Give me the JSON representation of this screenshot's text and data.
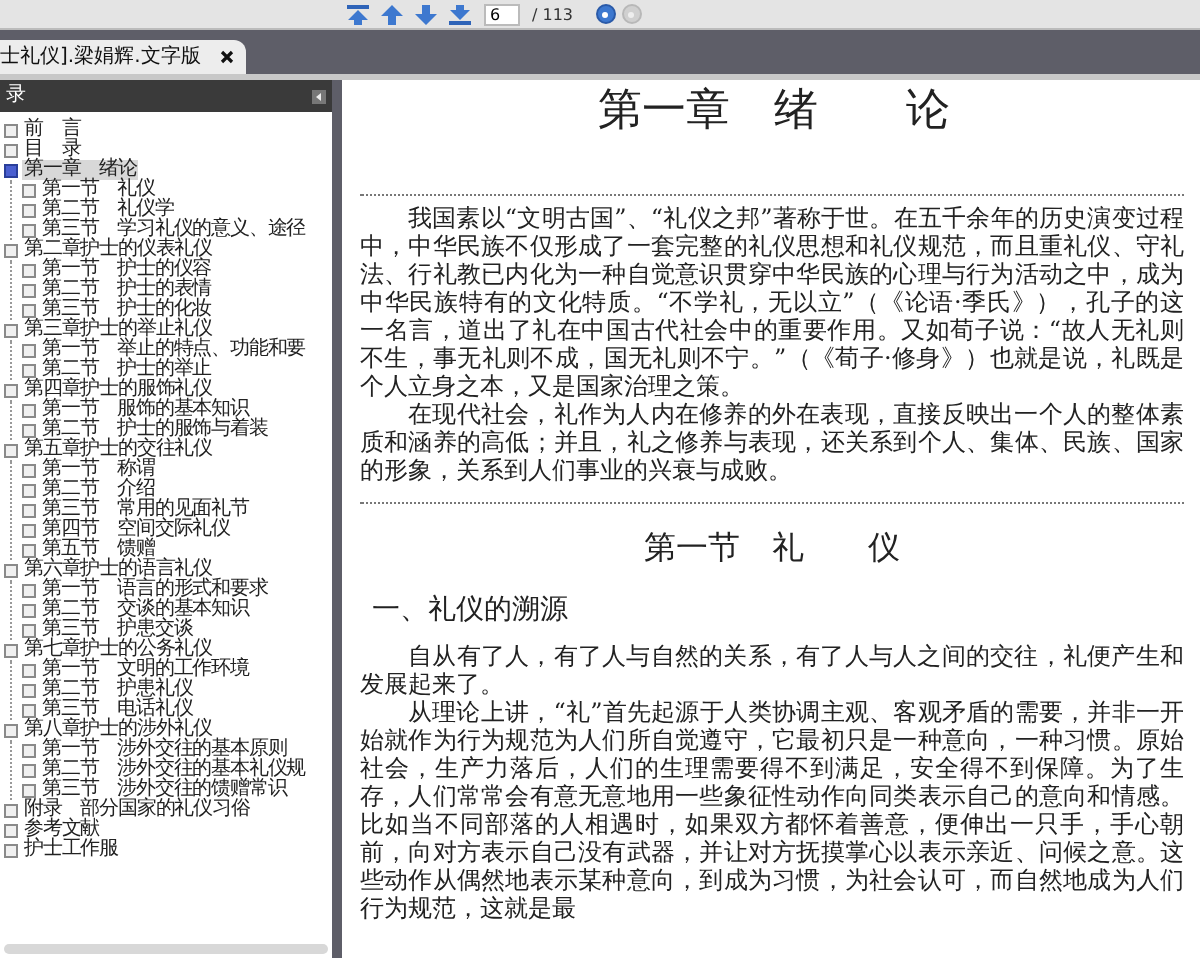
{
  "toolbar": {
    "page_input": "6",
    "page_total": "/ 113",
    "history": [
      {
        "disabled": false
      },
      {
        "disabled": true
      }
    ]
  },
  "tab": {
    "title": "士礼仪].梁娟辉.文字版"
  },
  "sidebar": {
    "title": "录",
    "items": [
      {
        "label": "前　言",
        "selected": false
      },
      {
        "label": "目　录",
        "selected": false
      },
      {
        "label": "第一章　绪论",
        "selected": true,
        "children": [
          {
            "label": "第一节　礼仪",
            "selected": false
          },
          {
            "label": "第二节　礼仪学",
            "selected": false
          },
          {
            "label": "第三节　学习礼仪的意义、途径",
            "selected": false
          }
        ]
      },
      {
        "label": "第二章护士的仪表礼仪",
        "selected": false,
        "children": [
          {
            "label": "第一节　护士的仪容",
            "selected": false
          },
          {
            "label": "第二节　护士的表情",
            "selected": false
          },
          {
            "label": "第三节　护士的化妆",
            "selected": false
          }
        ]
      },
      {
        "label": "第三章护士的举止礼仪",
        "selected": false,
        "children": [
          {
            "label": "第一节　举止的特点、功能和要",
            "selected": false
          },
          {
            "label": "第二节　护士的举止",
            "selected": false
          }
        ]
      },
      {
        "label": "第四章护士的服饰礼仪",
        "selected": false,
        "children": [
          {
            "label": "第一节　服饰的基本知识",
            "selected": false
          },
          {
            "label": "第二节　护士的服饰与着装",
            "selected": false
          }
        ]
      },
      {
        "label": "第五章护士的交往礼仪",
        "selected": false,
        "children": [
          {
            "label": "第一节　称谓",
            "selected": false
          },
          {
            "label": "第二节　介绍",
            "selected": false
          },
          {
            "label": "第三节　常用的见面礼节",
            "selected": false
          },
          {
            "label": "第四节　空间交际礼仪",
            "selected": false
          },
          {
            "label": "第五节　馈赠",
            "selected": false
          }
        ]
      },
      {
        "label": "第六章护士的语言礼仪",
        "selected": false,
        "children": [
          {
            "label": "第一节　语言的形式和要求",
            "selected": false
          },
          {
            "label": "第二节　交谈的基本知识",
            "selected": false
          },
          {
            "label": "第三节　护患交谈",
            "selected": false
          }
        ]
      },
      {
        "label": "第七章护士的公务礼仪",
        "selected": false,
        "children": [
          {
            "label": "第一节　文明的工作环境",
            "selected": false
          },
          {
            "label": "第二节　护患礼仪",
            "selected": false
          },
          {
            "label": "第三节　电话礼仪",
            "selected": false
          }
        ]
      },
      {
        "label": "第八章护士的涉外礼仪",
        "selected": false,
        "children": [
          {
            "label": "第一节　涉外交往的基本原则",
            "selected": false
          },
          {
            "label": "第二节　涉外交往的基本礼仪规",
            "selected": false
          },
          {
            "label": "第三节　涉外交往的馈赠常识",
            "selected": false
          }
        ]
      },
      {
        "label": "附录　部分国家的礼仪习俗",
        "selected": false
      },
      {
        "label": "参考文献",
        "selected": false
      },
      {
        "label": "护士工作服",
        "selected": false
      }
    ]
  },
  "page": {
    "chapter_title": "第一章　绪　　论",
    "intro": [
      "我国素以“文明古国”、“礼仪之邦”著称于世。在五千余年的历史演变过程中，中华民族不仅形成了一套完整的礼仪思想和礼仪规范，而且重礼仪、守礼法、行礼教已内化为一种自觉意识贯穿中华民族的心理与行为活动之中，成为中华民族特有的文化特质。“不学礼，无以立”（《论语·季氏》），孔子的这一名言，道出了礼在中国古代社会中的重要作用。又如荀子说：“故人无礼则不生，事无礼则不成，国无礼则不宁。”（《荀子·修身》）也就是说，礼既是个人立身之本，又是国家治理之策。",
      "在现代社会，礼作为人内在修养的外在表现，直接反映出一个人的整体素质和涵养的高低；并且，礼之修养与表现，还关系到个人、集体、民族、国家的形象，关系到人们事业的兴衰与成败。"
    ],
    "section_title": "第一节　礼　　仪",
    "subsection_title": "一、礼仪的溯源",
    "paragraphs": [
      "自从有了人，有了人与自然的关系，有了人与人之间的交往，礼便产生和发展起来了。",
      "从理论上讲，“礼”首先起源于人类协调主观、客观矛盾的需要，并非一开始就作为行为规范为人们所自觉遵守，它最初只是一种意向，一种习惯。原始社会，生产力落后，人们的生理需要得不到满足，安全得不到保障。为了生存，人们常常会有意无意地用一些象征性动作向同类表示自己的意向和情感。比如当不同部落的人相遇时，如果双方都怀着善意，便伸出一只手，手心朝前，向对方表示自己没有武器，并让对方抚摸掌心以表示亲近、问候之意。这些动作从偶然地表示某种意向，到成为习惯，为社会认可，而自然地成为人们行为规范，这就是最"
    ]
  }
}
